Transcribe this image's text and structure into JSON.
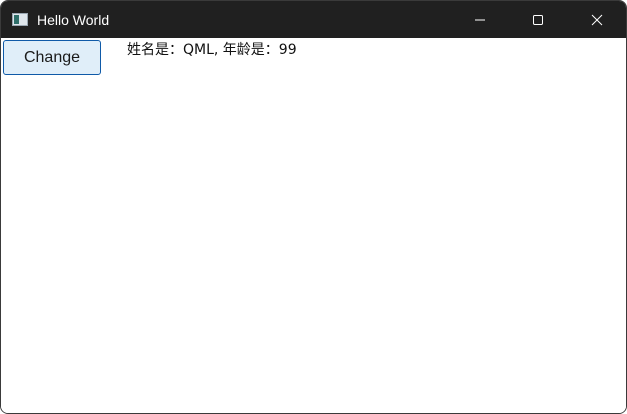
{
  "window": {
    "title": "Hello World",
    "icon": "app-window-icon",
    "controls": [
      "minimize-icon",
      "maximize-icon",
      "close-icon"
    ]
  },
  "main": {
    "change_button_label": "Change",
    "info_text": "姓名是：QML, 年龄是：99"
  },
  "colors": {
    "titlebar": "#202020",
    "button_bg": "#e0eef9",
    "button_border": "#0f5aa8"
  }
}
